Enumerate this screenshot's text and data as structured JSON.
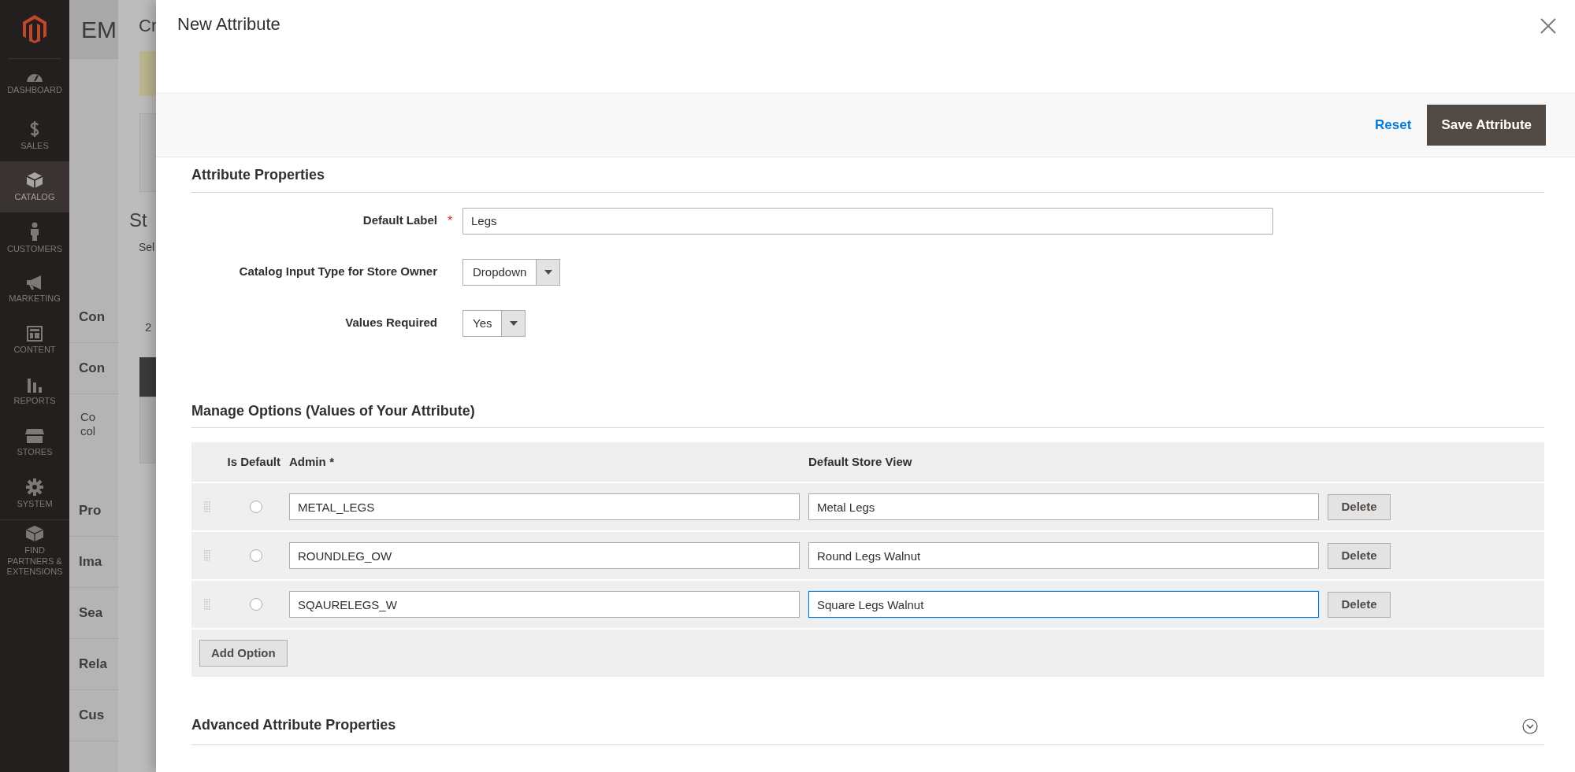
{
  "sidebar": {
    "items": [
      {
        "label": "DASHBOARD",
        "selected": false
      },
      {
        "label": "SALES",
        "selected": false
      },
      {
        "label": "CATALOG",
        "selected": true
      },
      {
        "label": "CUSTOMERS",
        "selected": false
      },
      {
        "label": "MARKETING",
        "selected": false
      },
      {
        "label": "CONTENT",
        "selected": false
      },
      {
        "label": "REPORTS",
        "selected": false
      },
      {
        "label": "STORES",
        "selected": false
      },
      {
        "label": "SYSTEM",
        "selected": false
      },
      {
        "label": "FIND PARTNERS & EXTENSIONS",
        "selected": false
      }
    ]
  },
  "background_page": {
    "header": "EM",
    "texts": [
      {
        "kind": "heading",
        "text": "Con"
      },
      {
        "kind": "heading",
        "text": "Con"
      },
      {
        "kind": "paragraph",
        "text": "Co"
      },
      {
        "kind": "paragraph",
        "text": "col"
      },
      {
        "kind": "heading",
        "text": "Pro"
      },
      {
        "kind": "heading",
        "text": "Ima"
      },
      {
        "kind": "heading",
        "text": "Sea"
      },
      {
        "kind": "heading",
        "text": "Rela"
      },
      {
        "kind": "heading",
        "text": "Cus"
      }
    ]
  },
  "background_modal": {
    "title": "Cr",
    "heading": "St",
    "subtext": "Sel",
    "count": "2"
  },
  "modal": {
    "title": "New Attribute",
    "actions": {
      "reset": "Reset",
      "save": "Save Attribute"
    },
    "attribute_properties": {
      "title": "Attribute Properties",
      "fields": [
        {
          "kind": "text",
          "label": "Default Label",
          "required_mark": "*",
          "value": "Legs"
        },
        {
          "kind": "select",
          "label": "Catalog Input Type for Store Owner",
          "value": "Dropdown"
        },
        {
          "kind": "select",
          "label": "Values Required",
          "value": "Yes"
        }
      ]
    },
    "manage_options": {
      "title": "Manage Options (Values of Your Attribute)",
      "columns": [
        {
          "label": "Is Default"
        },
        {
          "label": "Admin",
          "required_mark": "*"
        },
        {
          "label": "Default Store View"
        }
      ],
      "rows": [
        {
          "is_default": false,
          "admin": "METAL_LEGS",
          "store_view": "Metal Legs",
          "store_view_focused": false,
          "delete": "Delete"
        },
        {
          "is_default": false,
          "admin": "ROUNDLEG_OW",
          "store_view": "Round Legs Walnut",
          "store_view_focused": false,
          "delete": "Delete"
        },
        {
          "is_default": false,
          "admin": "SQAURELEGS_W",
          "store_view": "Square Legs Walnut",
          "store_view_focused": true,
          "delete": "Delete"
        }
      ],
      "add_button": "Add Option"
    },
    "advanced": {
      "title": "Advanced Attribute Properties",
      "expanded": false
    }
  }
}
